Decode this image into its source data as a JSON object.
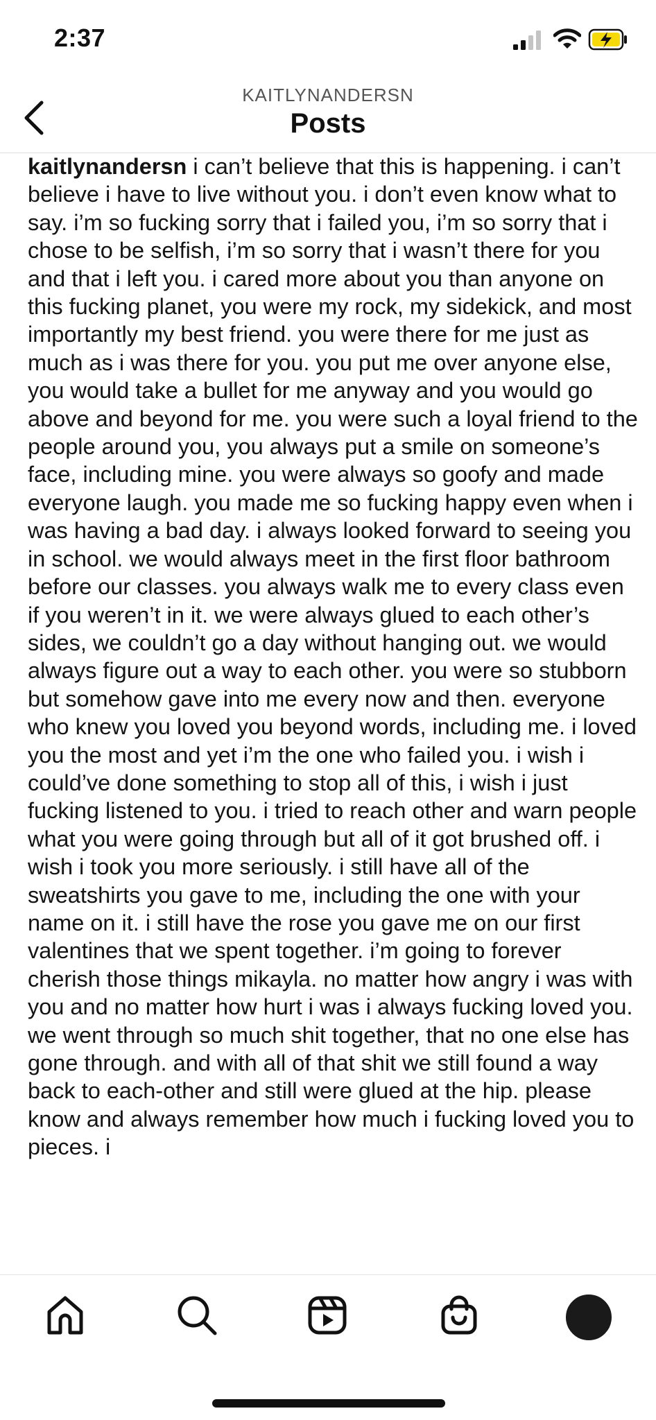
{
  "status_bar": {
    "time": "2:37",
    "battery_state": "charging"
  },
  "header": {
    "username": "KAITLYNANDERSN",
    "title": "Posts",
    "back_icon": "chevron-left-icon"
  },
  "post": {
    "username": "kaitlynandersn",
    "caption": "i can’t believe that this is happening. i can’t believe i have to live without you. i don’t even know what to say. i’m so fucking sorry that i failed you, i’m so sorry that i chose to be selfish, i’m so sorry that i wasn’t there for you and that i left you. i cared more about you than anyone on this fucking planet, you were my rock, my sidekick, and most importantly my best friend. you were there for me just as much as i was there for you. you put me over anyone else, you would take a bullet for me anyway and you would go above and beyond for me. you were such a loyal friend to the people around you, you always put a smile on someone’s face, including mine. you were always so goofy and made everyone laugh. you made me so fucking happy even when i was having a bad day. i always looked forward to seeing you in school. we would always meet in the first floor bathroom before our classes. you always walk me to every class even if you weren’t in it. we were always glued to each other’s sides, we couldn’t go a day without hanging out. we would always figure out a way to each other. you were so stubborn but somehow gave into me every now and then. everyone who knew you loved you beyond words, including me. i loved you the most and yet i’m the one who failed you. i wish i could’ve done something to stop all of this, i wish i just fucking listened to you. i tried to reach other and warn people what you were going through but all of it got brushed off. i wish i took you more seriously. i still have all of the sweatshirts you gave to me, including the one with your name on it. i still have the rose you gave me on our first valentines that we spent together. i’m going to forever cherish those things mikayla. no matter how angry i was with you and no matter how hurt i was i always fucking loved you. we went through so much shit together, that no one else has gone through. and with all of that shit we still found a way back to each-other and still were glued at the hip. please know and always remember how much i fucking loved you to pieces.  i"
  },
  "tab_bar": {
    "items": [
      {
        "icon": "home-icon"
      },
      {
        "icon": "search-icon"
      },
      {
        "icon": "reels-icon"
      },
      {
        "icon": "shop-icon"
      },
      {
        "icon": "profile-avatar"
      }
    ]
  },
  "colors": {
    "background": "#ffffff",
    "text": "#111111",
    "divider": "#dedede",
    "battery_charging": "#f5d90a"
  }
}
